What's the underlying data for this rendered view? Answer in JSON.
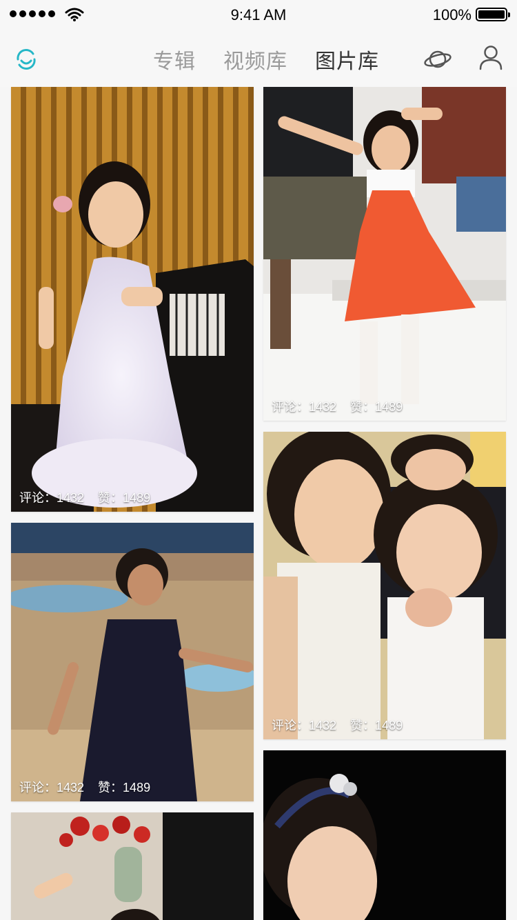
{
  "status": {
    "time": "9:41 AM",
    "battery": "100%"
  },
  "nav": {
    "tabs": [
      {
        "label": "专辑"
      },
      {
        "label": "视频库"
      },
      {
        "label": "图片库"
      }
    ],
    "active_tab": "图片库"
  },
  "photos": [
    {
      "comments": "评论：1432",
      "likes": "赞：1489",
      "desc": "girl in white dress by piano"
    },
    {
      "comments": "评论：1432",
      "likes": "赞：1489",
      "desc": "girl in orange dress on steps"
    },
    {
      "comments": "评论：1432",
      "likes": "赞：1489",
      "desc": "girl in dark dress dancing"
    },
    {
      "comments": "评论：1432",
      "likes": "赞：1489",
      "desc": "girls laughing together"
    },
    {
      "comments": "",
      "likes": "",
      "desc": "girl with flowers"
    },
    {
      "comments": "",
      "likes": "",
      "desc": "girl with headband"
    }
  ],
  "colors": {
    "accent": "#26b7c7",
    "inactive_tab": "#9a9a9a",
    "active_tab": "#333333"
  }
}
